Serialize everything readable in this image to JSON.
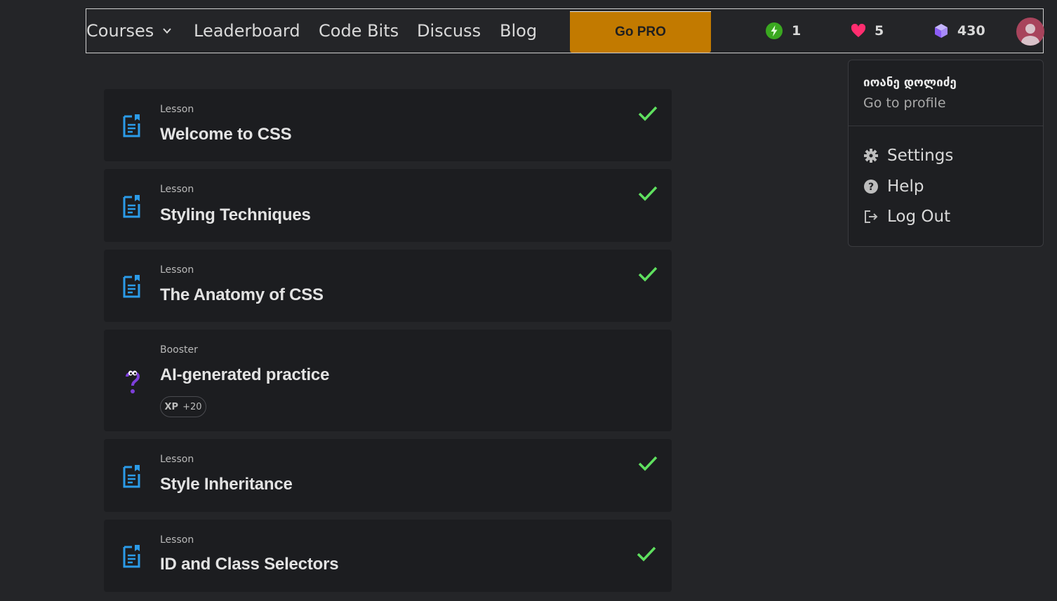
{
  "nav": {
    "courses": "Courses",
    "leaderboard": "Leaderboard",
    "code_bits": "Code Bits",
    "discuss": "Discuss",
    "blog": "Blog",
    "go_pro": "Go PRO",
    "streak_count": "1",
    "hearts_count": "5",
    "bits_count": "430"
  },
  "profile_menu": {
    "user_name": "იოანე დოლიძე",
    "go_to_profile": "Go to profile",
    "settings": "Settings",
    "help": "Help",
    "log_out": "Log Out"
  },
  "lessons": [
    {
      "kind": "Lesson",
      "title": "Welcome to CSS",
      "completed": true
    },
    {
      "kind": "Lesson",
      "title": "Styling Techniques",
      "completed": true
    },
    {
      "kind": "Lesson",
      "title": "The Anatomy of CSS",
      "completed": true
    },
    {
      "kind": "Booster",
      "title": "AI-generated practice",
      "completed": false,
      "xp_label": "XP",
      "xp_value": "+20"
    },
    {
      "kind": "Lesson",
      "title": "Style Inheritance",
      "completed": true
    },
    {
      "kind": "Lesson",
      "title": "ID and Class Selectors",
      "completed": true
    }
  ],
  "colors": {
    "accent_pro": "#c27a00",
    "check_green": "#5fe05f",
    "lesson_icon_blue": "#2b9be8",
    "booster_purple": "#7d3fd9",
    "heart_pink": "#ff2d6f",
    "bits_purple": "#a78bfa",
    "streak_green": "#3aa820"
  }
}
